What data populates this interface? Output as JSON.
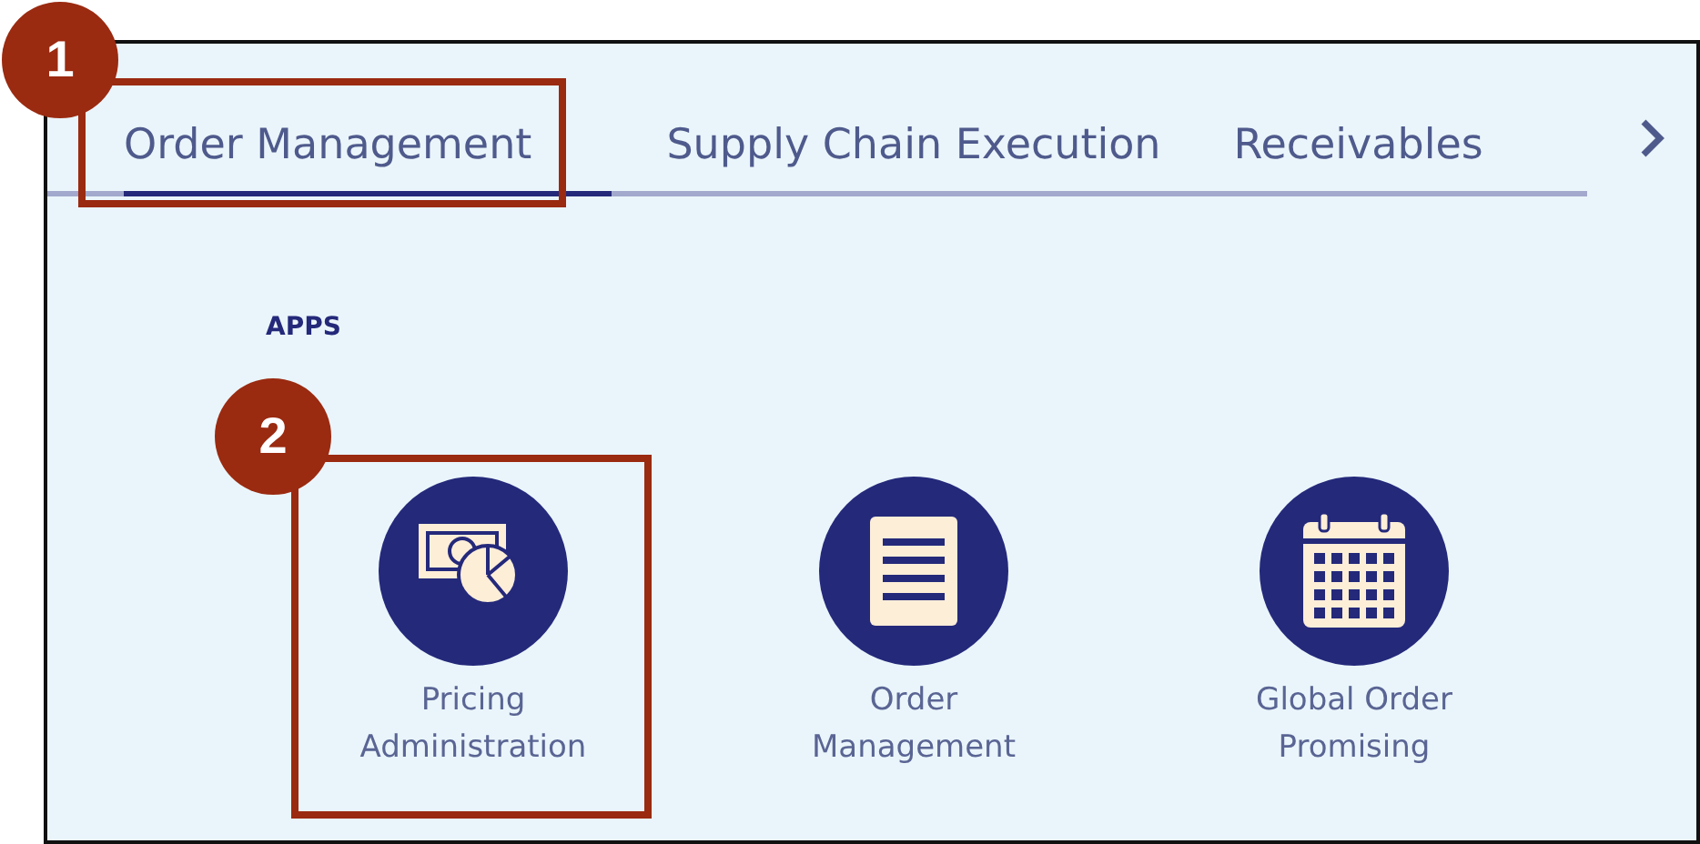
{
  "tabs": [
    {
      "label": "Order Management",
      "selected": true
    },
    {
      "label": "Supply Chain Execution",
      "selected": false
    },
    {
      "label": "Receivables",
      "selected": false
    }
  ],
  "section_title": "APPS",
  "apps": [
    {
      "kind": "pricing",
      "label": "Pricing Administration"
    },
    {
      "kind": "document",
      "label": "Order Management"
    },
    {
      "kind": "calendar",
      "label": "Global Order Promising"
    }
  ],
  "callouts": [
    {
      "number": "1"
    },
    {
      "number": "2"
    }
  ]
}
